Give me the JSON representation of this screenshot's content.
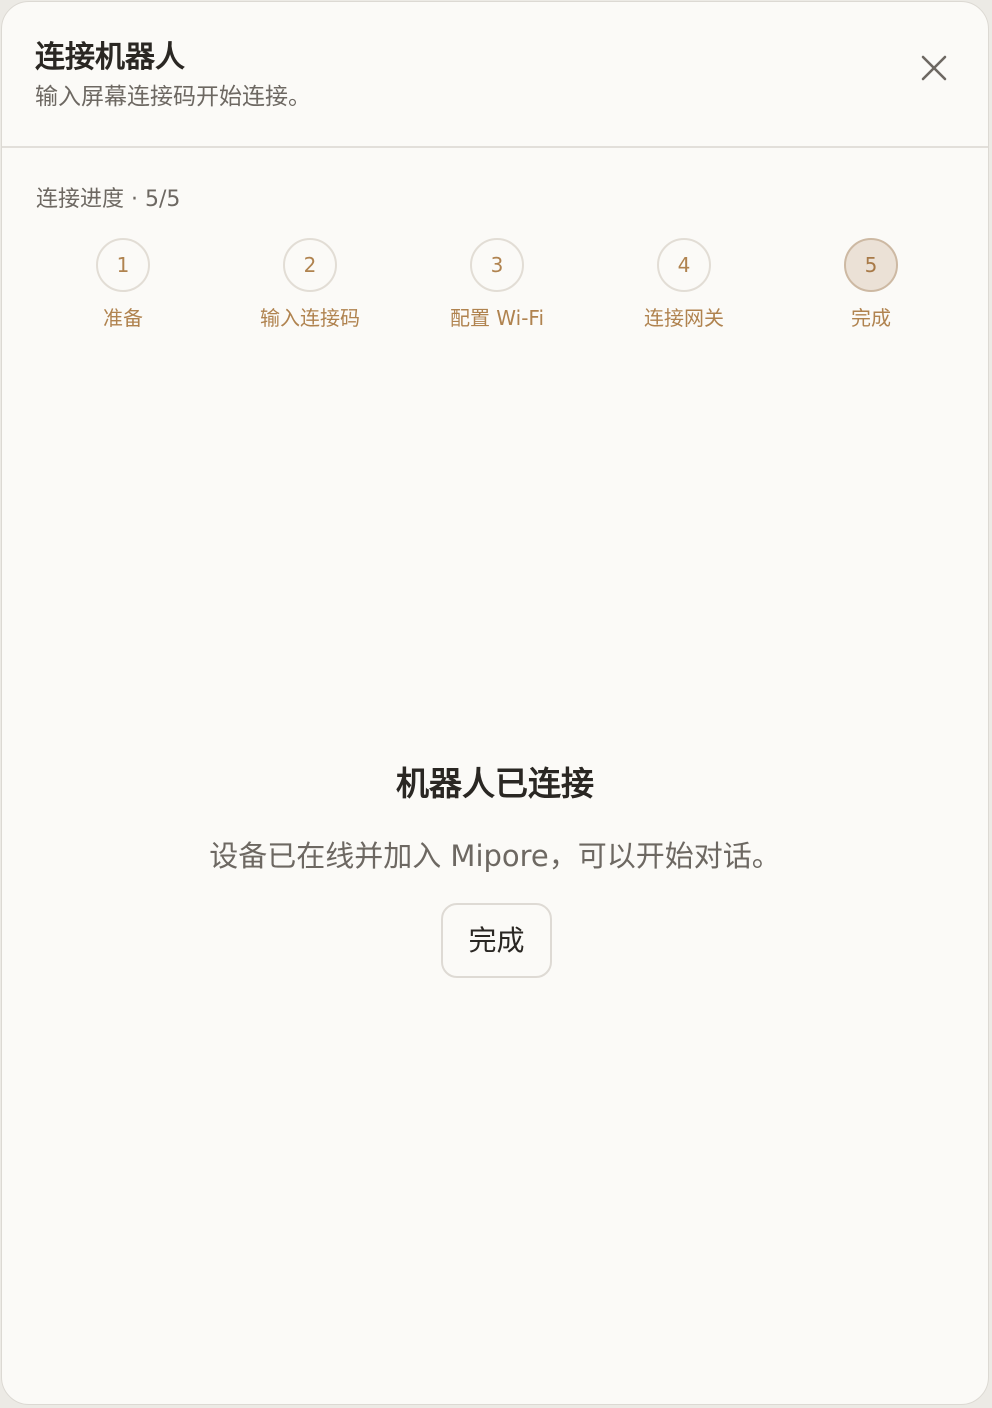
{
  "header": {
    "title": "连接机器人",
    "subtitle": "输入屏幕连接码开始连接。",
    "close_icon": "close-icon"
  },
  "progress": {
    "label": "连接进度 · 5/5",
    "current_step": 5,
    "total_steps": 5
  },
  "steps": [
    {
      "number": "1",
      "label": "准备"
    },
    {
      "number": "2",
      "label": "输入连接码"
    },
    {
      "number": "3",
      "label": "配置 Wi-Fi"
    },
    {
      "number": "4",
      "label": "连接网关"
    },
    {
      "number": "5",
      "label": "完成"
    }
  ],
  "result": {
    "title": "机器人已连接",
    "description": "设备已在线并加入 Mipore，可以开始对话。",
    "done_label": "完成"
  },
  "colors": {
    "accent": "#b0834f",
    "background": "#fbfaf7",
    "active_step_fill": "#ebe1d6"
  }
}
